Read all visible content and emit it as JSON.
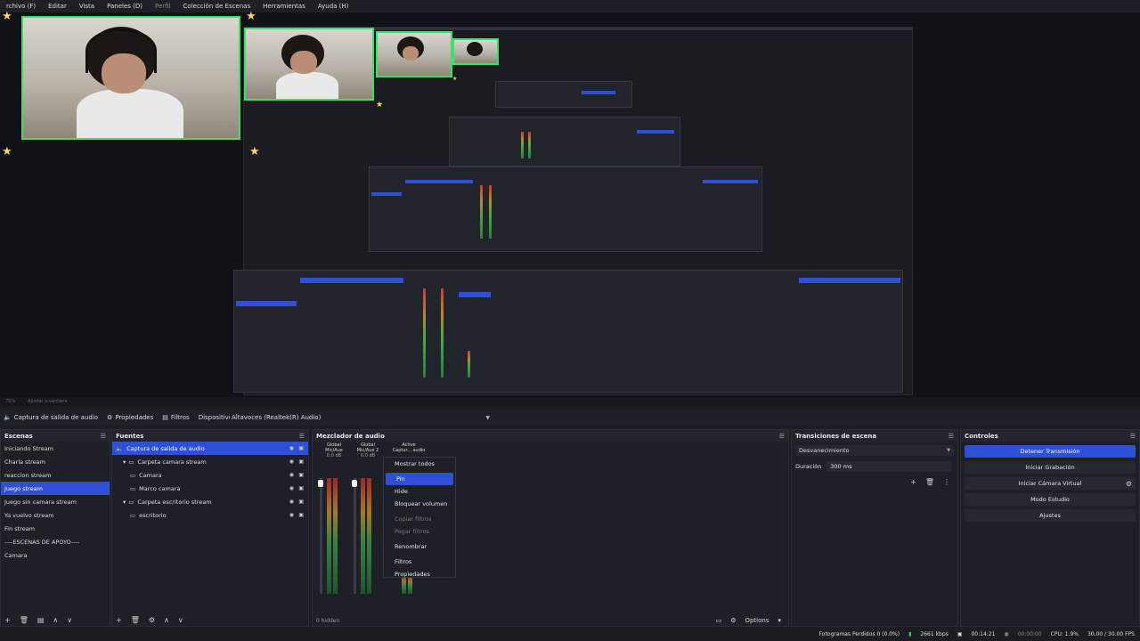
{
  "menubar": {
    "items": [
      {
        "label": "rchivo (F)",
        "dim": false
      },
      {
        "label": "Editar",
        "dim": false
      },
      {
        "label": "Vista",
        "dim": false
      },
      {
        "label": "Paneles (D)",
        "dim": false
      },
      {
        "label": "Perfil",
        "dim": true
      },
      {
        "label": "Colección de Escenas",
        "dim": false
      },
      {
        "label": "Herramientas",
        "dim": false
      },
      {
        "label": "Ayuda (H)",
        "dim": false
      }
    ]
  },
  "preview_status": {
    "left": "75%",
    "right": "Ajustar a ventana"
  },
  "context_bar": {
    "source": "Captura de salida de audio",
    "properties": "Propiedades",
    "filters": "Filtros",
    "device_label": "Dispositivo",
    "device_value": "Altavoces (Realtek(R) Audio)"
  },
  "scenes": {
    "title": "Escenas",
    "items": [
      {
        "label": "Iniciando Stream"
      },
      {
        "label": "Charla stream"
      },
      {
        "label": "reaccion stream"
      },
      {
        "label": "Juego stream",
        "selected": true
      },
      {
        "label": "Juego sin camara stream"
      },
      {
        "label": "Ya vuelvo stream"
      },
      {
        "label": "Fin stream"
      },
      {
        "label": "----ESCENAS DE APOYO----"
      },
      {
        "label": "Camara"
      }
    ]
  },
  "sources": {
    "title": "Fuentes",
    "items": [
      {
        "label": "Captura de salida de audio",
        "indent": 0,
        "selected": true,
        "icon": "speaker-icon"
      },
      {
        "label": "Carpeta camara stream",
        "indent": 1,
        "icon": "folder-icon",
        "expand": true
      },
      {
        "label": "Camara",
        "indent": 2,
        "icon": "camera-icon"
      },
      {
        "label": "Marco camara",
        "indent": 2,
        "icon": "image-icon"
      },
      {
        "label": "Carpeta escritorio stream",
        "indent": 1,
        "icon": "folder-icon",
        "expand": true
      },
      {
        "label": "escritorio",
        "indent": 2,
        "icon": "monitor-icon"
      }
    ]
  },
  "mixer": {
    "title": "Mezclador de audio",
    "strips": [
      {
        "tag": "Global",
        "name": "Mic/Aux",
        "db": "0.0 dB"
      },
      {
        "tag": "Global",
        "name": "Mic/Aux 2",
        "db": "0.0 dB"
      },
      {
        "tag": "Active",
        "name": "Captur... audio",
        "db": ""
      }
    ],
    "hidden_label": "0 hidden",
    "options_label": "Options"
  },
  "context_menu": {
    "items": [
      {
        "label": "Mostrar todos",
        "state": "normal"
      },
      {
        "label": "Pin",
        "state": "hover"
      },
      {
        "label": "Hide",
        "state": "normal"
      },
      {
        "label": "Bloquear volumen",
        "state": "normal"
      },
      {
        "label": "Copiar filtros",
        "state": "disabled"
      },
      {
        "label": "Pegar filtros",
        "state": "disabled"
      },
      {
        "label": "Renombrar",
        "state": "normal"
      },
      {
        "label": "Filtros",
        "state": "normal"
      },
      {
        "label": "Propiedades",
        "state": "normal"
      }
    ]
  },
  "transitions": {
    "title": "Transiciones de escena",
    "selected": "Desvanecimiento",
    "duration_label": "Duración",
    "duration_value": "300 ms"
  },
  "controls": {
    "title": "Controles",
    "buttons": [
      {
        "label": "Detener Transmisión",
        "primary": true
      },
      {
        "label": "Iniciar Grabación"
      },
      {
        "label": "Iniciar Cámara Virtual",
        "gear": true
      },
      {
        "label": "Modo Estudio"
      },
      {
        "label": "Ajustes"
      }
    ]
  },
  "statusbar": {
    "dropped": "Fotogramas Perdidos 0 (0.0%)",
    "kbps": "2661 kbps",
    "live_time": "00:14:21",
    "rec_time": "00:00:00",
    "cpu": "CPU: 1.9%",
    "fps": "30.00 / 30.00 FPS"
  },
  "colors": {
    "accent": "#2e4fd6",
    "panel": "#1f2027",
    "camera_border": "#3de06a"
  }
}
